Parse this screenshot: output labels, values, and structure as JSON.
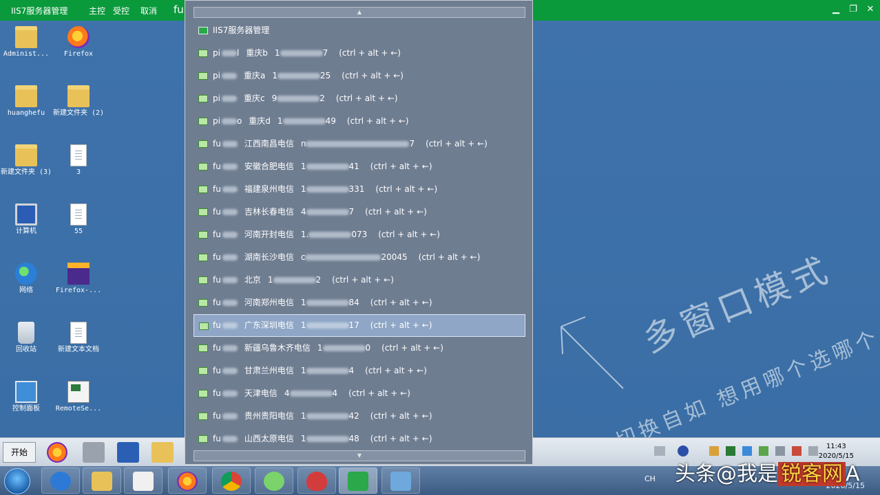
{
  "window": {
    "app_title": "IIS7服务器管理",
    "menu": [
      "主控",
      "受控",
      "取消"
    ],
    "address_fragment": "fu",
    "controls": [
      "▁",
      "❐",
      "✕"
    ]
  },
  "desktop_icons": [
    {
      "label": "Administ..."
    },
    {
      "label": "Firefox"
    },
    {
      "label": "huanghefu"
    },
    {
      "label": "新建文件夹 (2)"
    },
    {
      "label": "新建文件夹 (3)"
    },
    {
      "label": "3"
    },
    {
      "label": "计算机"
    },
    {
      "label": "55"
    },
    {
      "label": "网络"
    },
    {
      "label": "Firefox-..."
    },
    {
      "label": "回收站"
    },
    {
      "label": "新建文本文档"
    },
    {
      "label": "控制面板"
    },
    {
      "label": "RemoteSe..."
    }
  ],
  "dropdown": {
    "scroll_up": "▲",
    "scroll_down": "▼",
    "header": "IIS7服务器管理",
    "items": [
      {
        "prefix": "pi",
        "suffix": "l",
        "region": "重庆b",
        "ip_start": "1",
        "ip_end": "7",
        "hotkey": "(ctrl + alt + ←)"
      },
      {
        "prefix": "pi",
        "suffix": "",
        "region": "重庆a",
        "ip_start": "1",
        "ip_end": "25",
        "hotkey": "(ctrl + alt + ←)"
      },
      {
        "prefix": "pi",
        "suffix": "",
        "region": "重庆c",
        "ip_start": "9",
        "ip_end": "2",
        "hotkey": "(ctrl + alt + ←)"
      },
      {
        "prefix": "pi",
        "suffix": "o",
        "region": "重庆d",
        "ip_start": "1",
        "ip_end": "49",
        "hotkey": "(ctrl + alt + ←)"
      },
      {
        "prefix": "fu",
        "suffix": "",
        "region": "江西南昌电信",
        "ip_start": "n",
        "ip_end": "7",
        "hotkey": "(ctrl + alt + ←)"
      },
      {
        "prefix": "fu",
        "suffix": "",
        "region": "安徽合肥电信",
        "ip_start": "1",
        "ip_end": "41",
        "hotkey": "(ctrl + alt + ←)"
      },
      {
        "prefix": "fu",
        "suffix": "",
        "region": "福建泉州电信",
        "ip_start": "1",
        "ip_end": "331",
        "hotkey": "(ctrl + alt + ←)"
      },
      {
        "prefix": "fu",
        "suffix": "",
        "region": "吉林长春电信",
        "ip_start": "4",
        "ip_end": "7",
        "hotkey": "(ctrl + alt + ←)"
      },
      {
        "prefix": "fu",
        "suffix": "",
        "region": "河南开封电信",
        "ip_start": "1.",
        "ip_end": "073",
        "hotkey": "(ctrl + alt + ←)"
      },
      {
        "prefix": "fu",
        "suffix": "",
        "region": "湖南长沙电信",
        "ip_start": "c",
        "ip_end": "20045",
        "hotkey": "(ctrl + alt + ←)"
      },
      {
        "prefix": "fu",
        "suffix": "",
        "region": "北京",
        "ip_start": "1",
        "ip_end": "2",
        "hotkey": "(ctrl + alt + ←)"
      },
      {
        "prefix": "fu",
        "suffix": "",
        "region": "河南郑州电信",
        "ip_start": "1",
        "ip_end": "84",
        "hotkey": "(ctrl + alt + ←)"
      },
      {
        "prefix": "fu",
        "suffix": "",
        "region": "广东深圳电信",
        "ip_start": "1",
        "ip_end": "17",
        "hotkey": "(ctrl + alt + ←)"
      },
      {
        "prefix": "fu",
        "suffix": "",
        "region": "新疆乌鲁木齐电信",
        "ip_start": "1",
        "ip_end": "0",
        "hotkey": "(ctrl + alt + ←)"
      },
      {
        "prefix": "fu",
        "suffix": "",
        "region": "甘肃兰州电信",
        "ip_start": "1",
        "ip_end": "4",
        "hotkey": "(ctrl + alt + ←)"
      },
      {
        "prefix": "fu",
        "suffix": "",
        "region": "天津电信",
        "ip_start": "4",
        "ip_end": "4",
        "hotkey": "(ctrl + alt + ←)"
      },
      {
        "prefix": "fu",
        "suffix": "",
        "region": "贵州贵阳电信",
        "ip_start": "1",
        "ip_end": "42",
        "hotkey": "(ctrl + alt + ←)"
      },
      {
        "prefix": "fu",
        "suffix": "",
        "region": "山西太原电信",
        "ip_start": "1",
        "ip_end": "48",
        "hotkey": "(ctrl + alt + ←)"
      }
    ]
  },
  "watermark": {
    "line1": "多窗口模式",
    "line2": "切换自如 想用哪个选哪个"
  },
  "remote_taskbar": {
    "start_label": "开始",
    "clock_time": "11:43",
    "clock_date": "2020/5/15"
  },
  "host_taskbar": {
    "lang": "CH",
    "clock_date": "2020/5/15",
    "brand_text": "头条@我是",
    "brand_highlight": "锐客网",
    "brand_tail": "A"
  },
  "colors": {
    "titlebar": "#0a9a3c",
    "dropdown_bg": "#6f7d91",
    "selected_row": "#8fa6c6",
    "desktop": "#3a6ea5"
  }
}
